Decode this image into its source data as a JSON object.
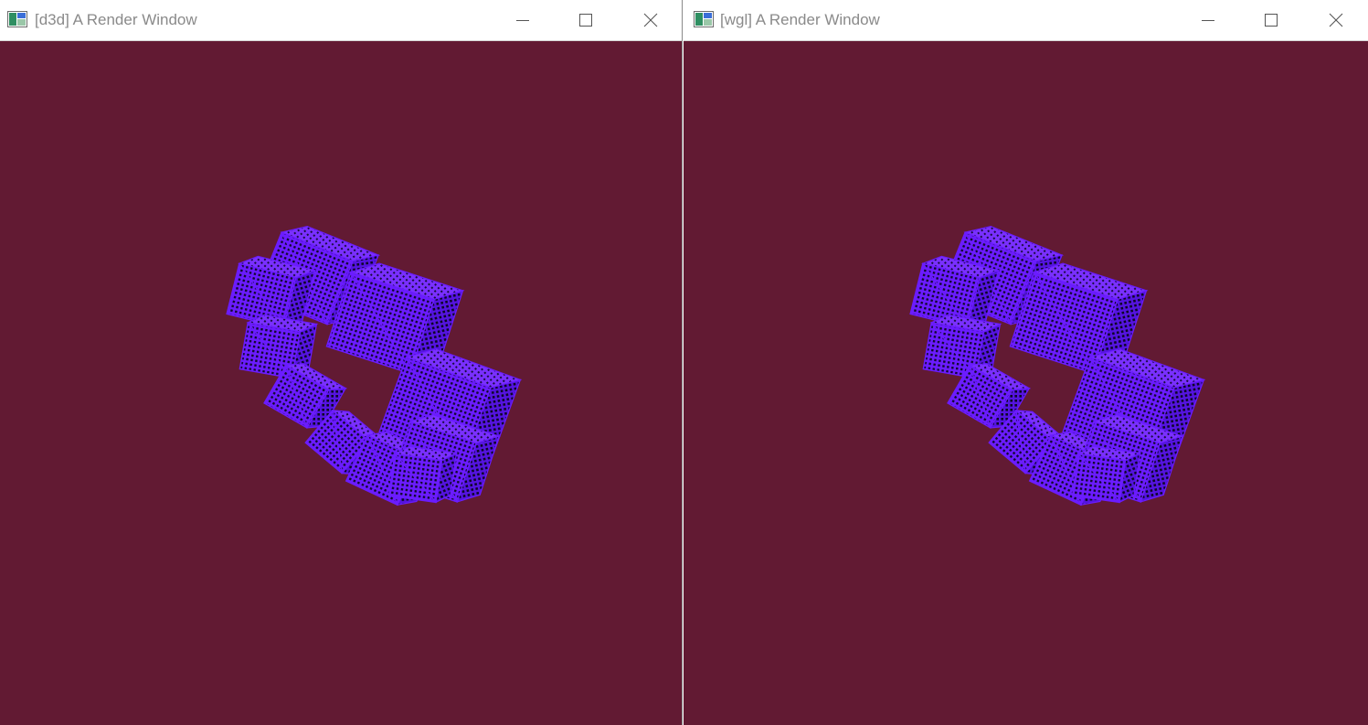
{
  "windows": [
    {
      "title": "[d3d] A Render Window",
      "icon": "vtk-render-window-icon",
      "background_color": "#621a33"
    },
    {
      "title": "[wgl] A Render Window",
      "icon": "vtk-render-window-icon",
      "background_color": "#621a33"
    }
  ],
  "controls": {
    "minimize": "minimize-icon",
    "maximize": "maximize-icon",
    "close": "close-icon"
  },
  "scene": {
    "object": "ring of wireframe cubes",
    "cube_color": "#6b1cff",
    "cube_count": 10
  }
}
